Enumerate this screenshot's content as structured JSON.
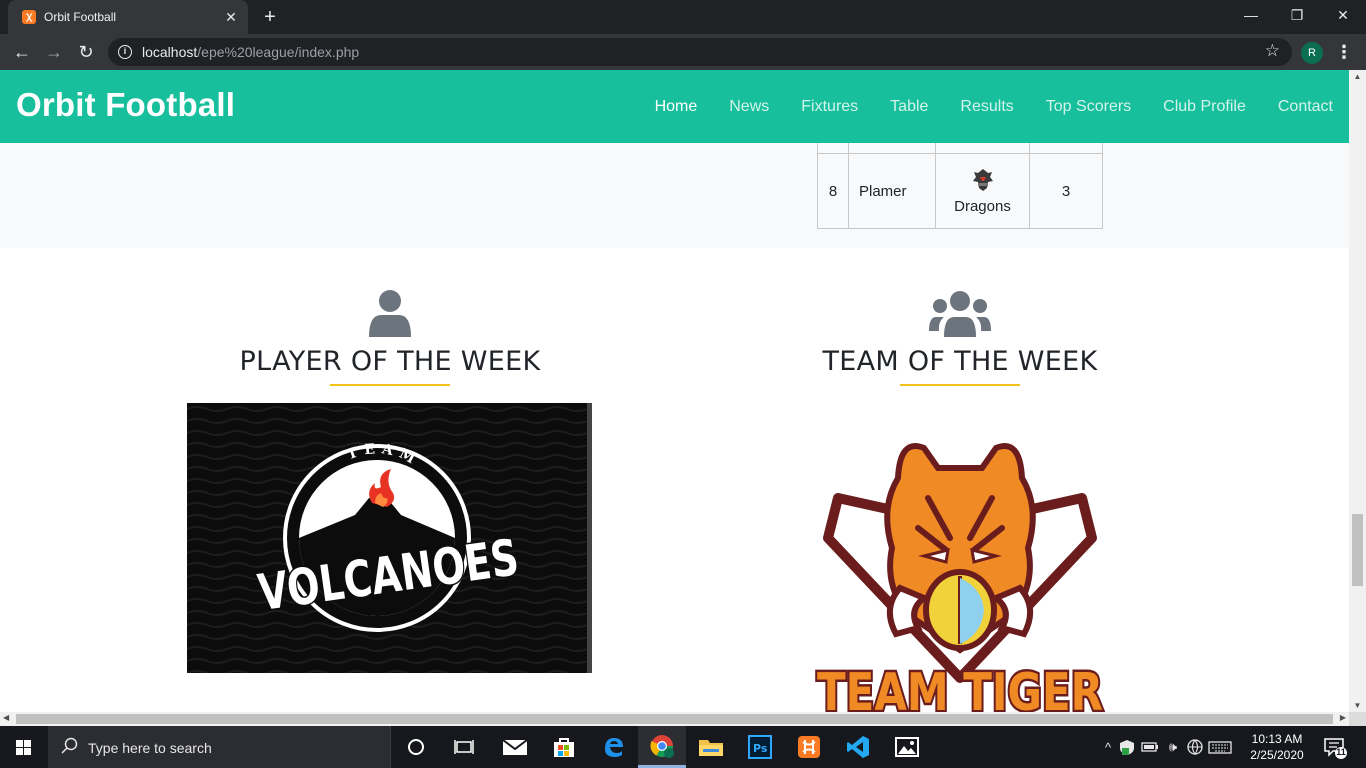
{
  "browser": {
    "tab_title": "Orbit Football",
    "favicon_glyph": "ꭓ",
    "new_tab_glyph": "+",
    "close_glyph": "✕",
    "url_host": "localhost",
    "url_path": "/epe%20league/index.php",
    "profile_initial": "R",
    "window_controls": {
      "minimize": "—",
      "maximize": "❐",
      "close": "✕"
    }
  },
  "site": {
    "brand": "Orbit Football",
    "nav": [
      {
        "label": "Home",
        "active": true
      },
      {
        "label": "News"
      },
      {
        "label": "Fixtures"
      },
      {
        "label": "Table"
      },
      {
        "label": "Results"
      },
      {
        "label": "Top Scorers"
      },
      {
        "label": "Club Profile"
      },
      {
        "label": "Contact"
      }
    ],
    "scorers_row": {
      "pos": "8",
      "player": "Plamer",
      "club": "Dragons",
      "goals": "3"
    },
    "player_of_week": {
      "heading": "PLAYER OF THE WEEK",
      "logo_top_text": "TEAM",
      "logo_main_text": "VOLCANOES"
    },
    "team_of_week": {
      "heading": "TEAM OF THE WEEK",
      "logo_text": "TEAM TIGER"
    }
  },
  "taskbar": {
    "search_placeholder": "Type here to search",
    "time": "10:13 AM",
    "date": "2/25/2020",
    "notification_count": "11"
  },
  "colors": {
    "nav_bg": "#17bf9c",
    "accent_underline": "#f0c21a",
    "icon_grey": "#6c757d"
  }
}
